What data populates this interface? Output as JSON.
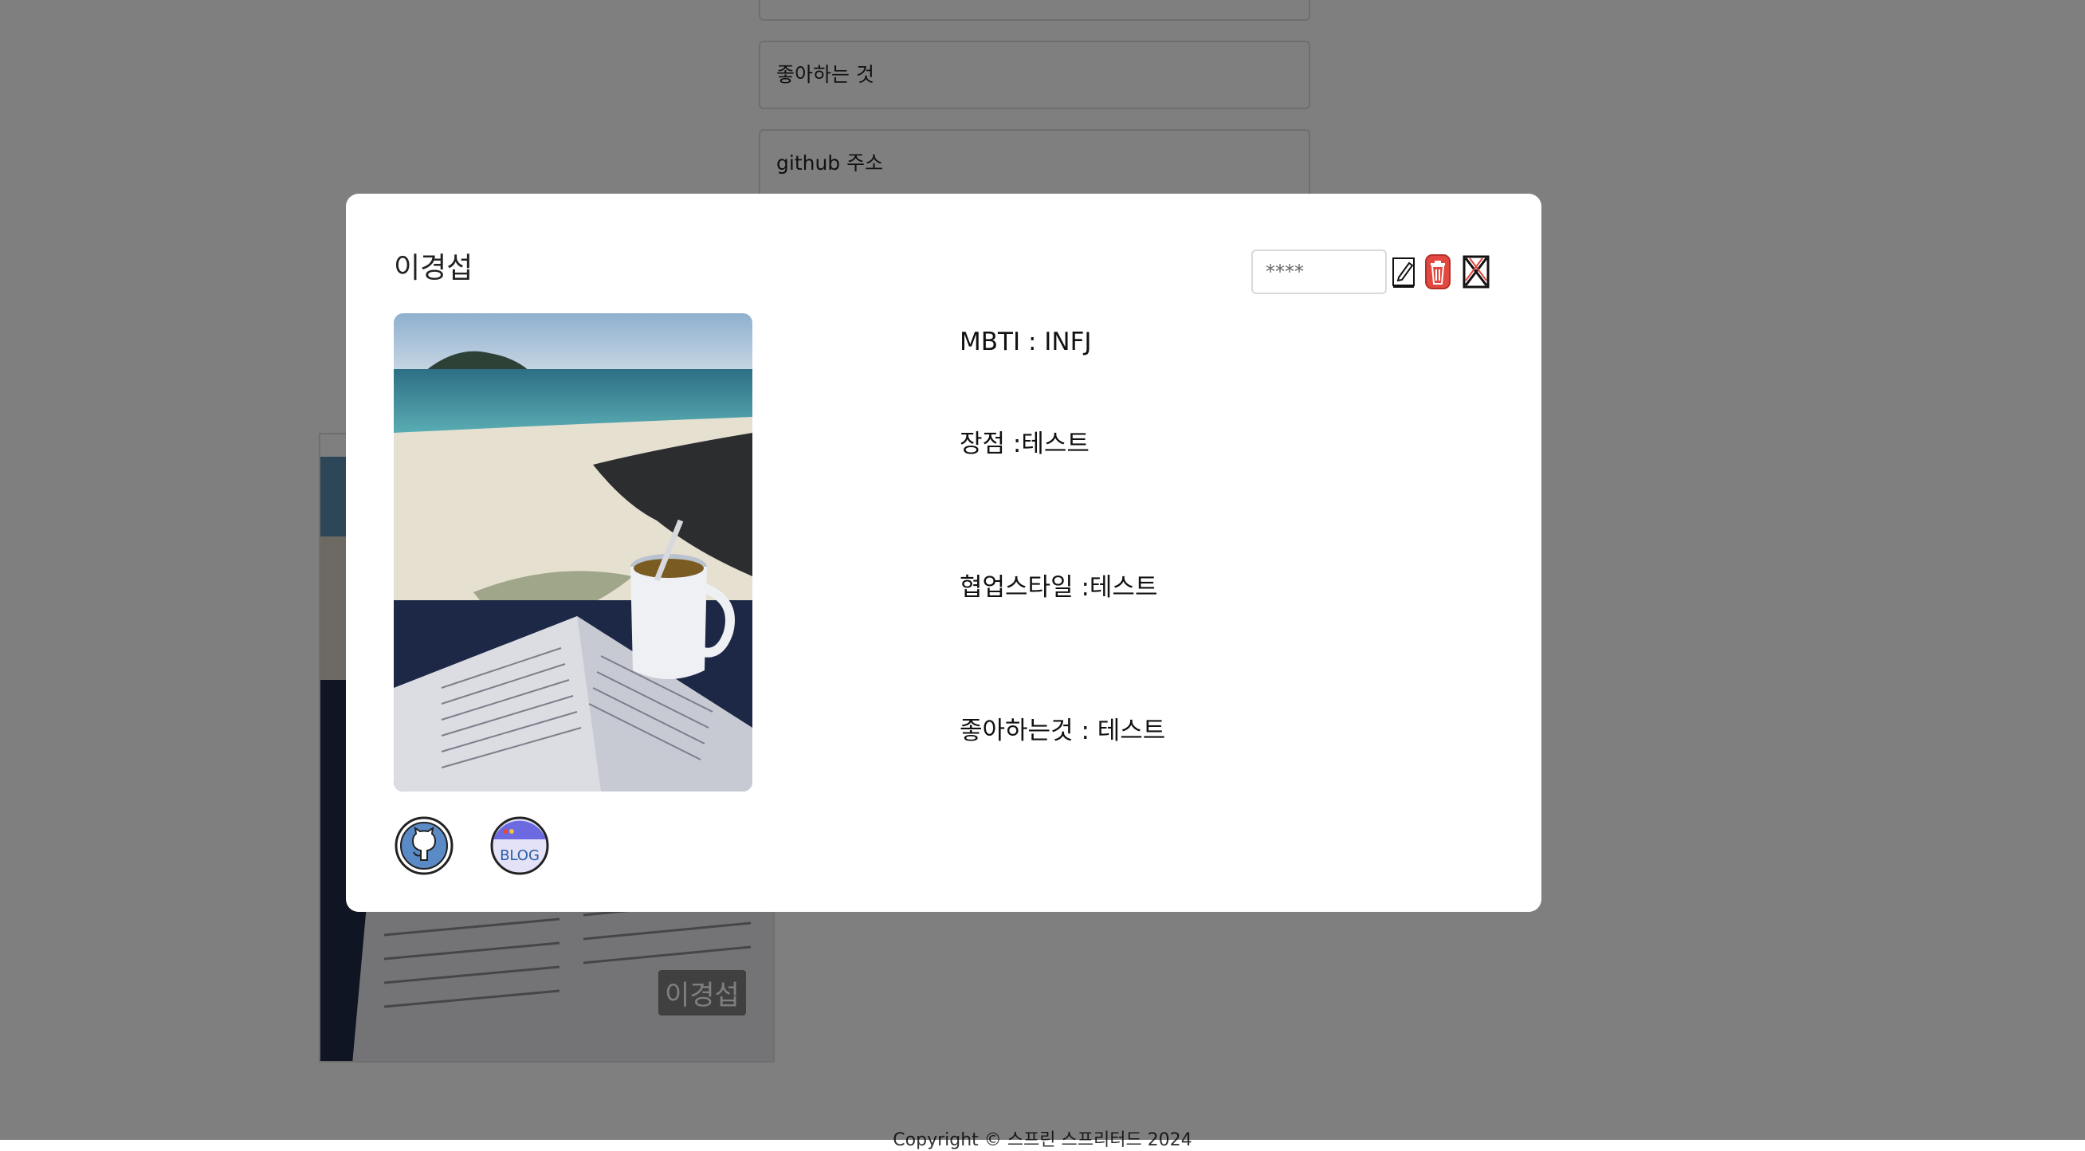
{
  "background": {
    "fields": [
      {
        "label": ""
      },
      {
        "label": "좋아하는 것"
      },
      {
        "label": "github 주소"
      }
    ],
    "card_name": "이경섭",
    "footer": "Copyright © 스프린 스프리터드 2024"
  },
  "modal": {
    "name": "이경섭",
    "password_placeholder": "****",
    "mbti": "MBTI : INFJ",
    "strength": "장점 :테스트",
    "collab": "협업스타일 :테스트",
    "likes": "좋아하는것 : 테스트",
    "blog_label": "BLOG"
  },
  "colors": {
    "overlay": "rgba(0,0,0,0.5)",
    "delete_red": "#e2483f",
    "blog_purple": "#5b5bd6"
  },
  "icons": [
    "edit-icon",
    "trash-icon",
    "close-icon",
    "github-icon",
    "blog-icon"
  ]
}
